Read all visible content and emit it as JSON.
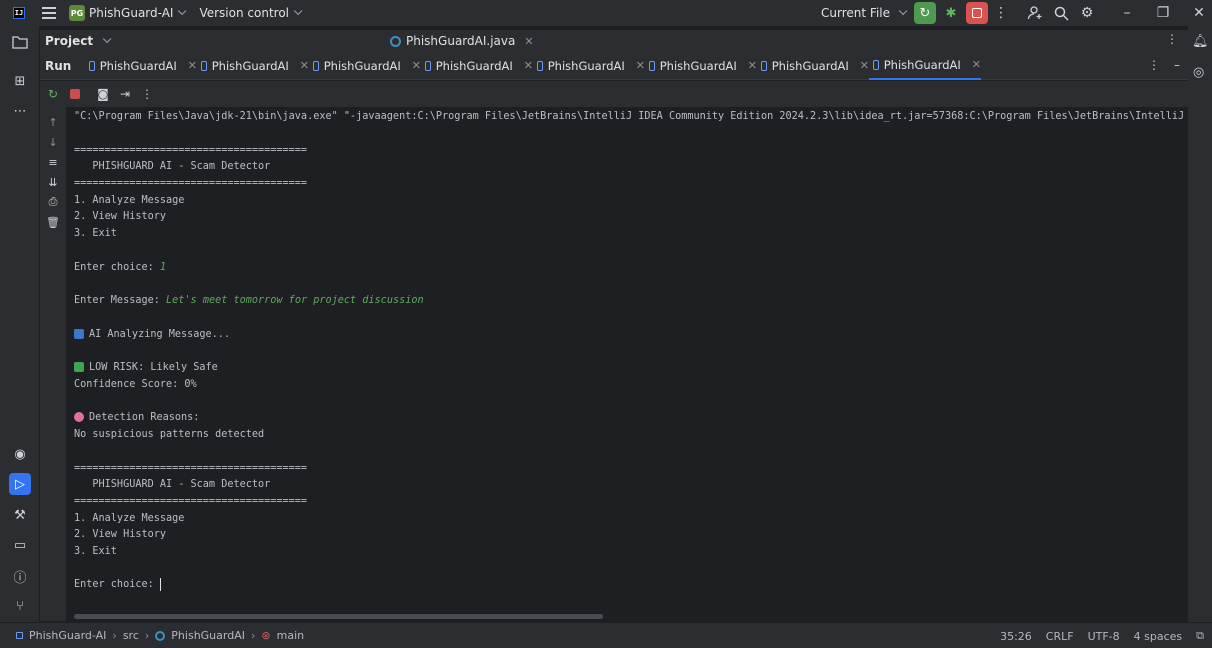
{
  "titlebar": {
    "app_logo": "IJ",
    "project_badge": "PG",
    "project_name": "PhishGuard-AI",
    "version_control": "Version control",
    "current_file": "Current File"
  },
  "project_panel": {
    "label": "Project"
  },
  "editor": {
    "tab_label": "PhishGuardAI.java"
  },
  "run_panel": {
    "title": "Run",
    "tabs": [
      "PhishGuardAI",
      "PhishGuardAI",
      "PhishGuardAI",
      "PhishGuardAI",
      "PhishGuardAI",
      "PhishGuardAI",
      "PhishGuardAI",
      "PhishGuardAI"
    ],
    "active_tab_index": 7
  },
  "console": {
    "command": "\"C:\\Program Files\\Java\\jdk-21\\bin\\java.exe\" \"-javaagent:C:\\Program Files\\JetBrains\\IntelliJ IDEA Community Edition 2024.2.3\\lib\\idea_rt.jar=57368:C:\\Program Files\\JetBrains\\IntelliJ ID",
    "separator": "======================================",
    "header": "   PHISHGUARD AI - Scam Detector",
    "menu1": "1. Analyze Message",
    "menu2": "2. View History",
    "menu3": "3. Exit",
    "enter_choice": "Enter choice: ",
    "choice_value": "1",
    "enter_message": "Enter Message: ",
    "message_value": "Let's meet tomorrow for project discussion",
    "analyzing": "AI Analyzing Message...",
    "risk": "LOW RISK: Likely Safe",
    "confidence": "Confidence Score: 0%",
    "reasons_title": "Detection Reasons:",
    "reasons_text": "No suspicious patterns detected",
    "colors": {
      "analyzing_icon": "#3a78c9",
      "risk_icon": "#3fa650",
      "reasons_icon": "#e26fa0",
      "input_text": "#5fa95f"
    }
  },
  "statusbar": {
    "breadcrumb": [
      "PhishGuard-AI",
      "src",
      "PhishGuardAI",
      "main"
    ],
    "position": "35:26",
    "line_sep": "CRLF",
    "encoding": "UTF-8",
    "indent": "4 spaces"
  }
}
